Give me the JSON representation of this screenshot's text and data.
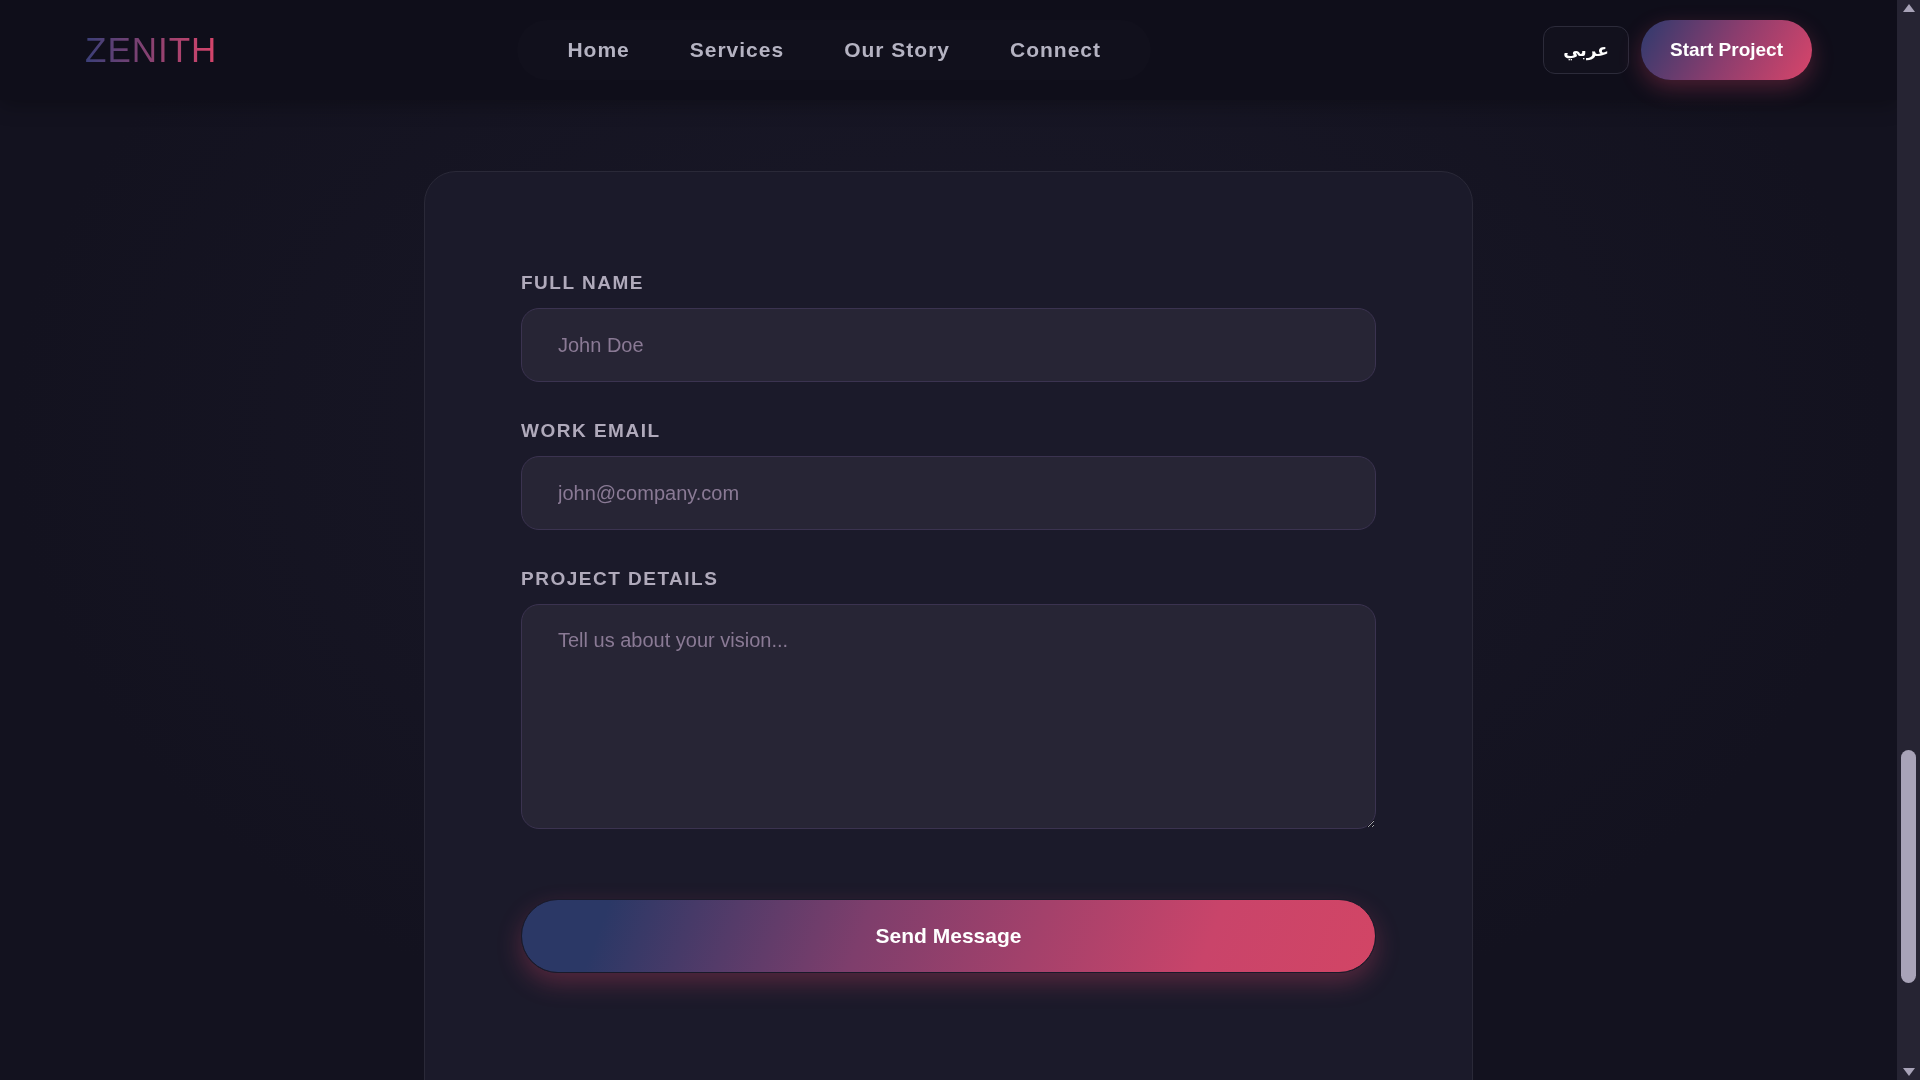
{
  "header": {
    "logo": "ZENITH",
    "nav": [
      {
        "label": "Home"
      },
      {
        "label": "Services"
      },
      {
        "label": "Our Story"
      },
      {
        "label": "Connect"
      }
    ],
    "language_button": "عربي",
    "cta_button": "Start Project"
  },
  "form": {
    "fields": [
      {
        "kind": "input",
        "label": "FULL NAME",
        "placeholder": "John Doe"
      },
      {
        "kind": "input",
        "label": "WORK EMAIL",
        "placeholder": "john@company.com"
      },
      {
        "kind": "textarea",
        "label": "PROJECT DETAILS",
        "placeholder": "Tell us about your vision..."
      }
    ],
    "submit": "Send Message"
  }
}
